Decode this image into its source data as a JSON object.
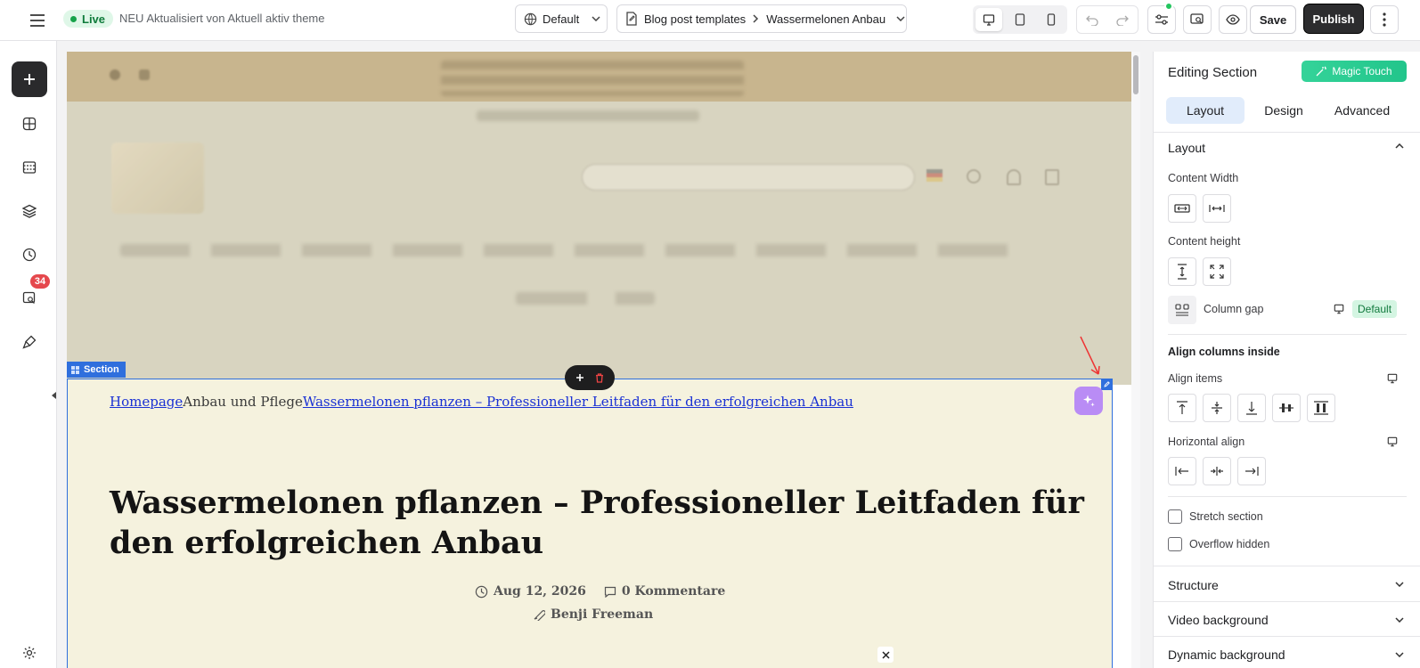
{
  "topbar": {
    "live_label": "Live",
    "theme_name": "NEU Aktualisiert von Aktuell aktiv theme",
    "locale_value": "Default",
    "template_group": "Blog post templates",
    "template_name": "Wassermelonen Anbau",
    "save_label": "Save",
    "publish_label": "Publish"
  },
  "rail": {
    "badge_count": "34"
  },
  "preview": {
    "section_tag": "Section",
    "breadcrumb": {
      "home": "Homepage",
      "category": "Anbau und Pflege",
      "current": "Wassermelonen pflanzen – Professioneller Leitfaden für den erfolgreichen Anbau"
    },
    "title": "Wassermelonen pflanzen – Professioneller Leitfaden für den erfolgreichen Anbau",
    "date": "Aug 12, 2026",
    "comments": "0 Kommentare",
    "author": "Benji Freeman"
  },
  "panel": {
    "title": "Editing Section",
    "magic_label": "Magic Touch",
    "tabs": [
      "Layout",
      "Design",
      "Advanced"
    ],
    "layout_head": "Layout",
    "content_width": "Content Width",
    "content_height": "Content height",
    "column_gap": "Column gap",
    "column_gap_value": "Default",
    "align_columns_head": "Align columns inside",
    "align_items": "Align items",
    "horizontal_align": "Horizontal align",
    "stretch_section": "Stretch section",
    "overflow_hidden": "Overflow hidden",
    "collapsed_sections": [
      "Structure",
      "Video background",
      "Dynamic background"
    ]
  },
  "colors": {
    "accent_blue": "#2f6fdd",
    "live_green": "#16a34a",
    "magic_green": "#22c58b",
    "badge_red": "#e5484d",
    "section_bg": "#f5f2de"
  }
}
